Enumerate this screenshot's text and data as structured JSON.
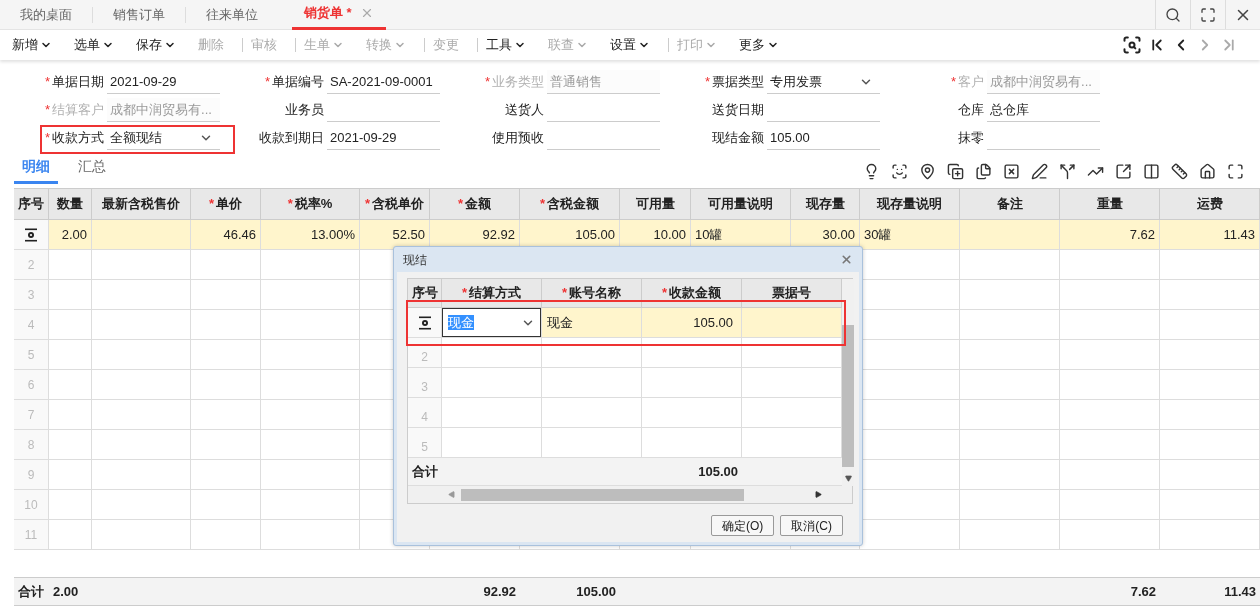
{
  "tabs": [
    {
      "label": "我的桌面",
      "selected": false,
      "closable": false
    },
    {
      "label": "销售订单",
      "selected": false,
      "closable": false
    },
    {
      "label": "往来单位",
      "selected": false,
      "closable": false
    },
    {
      "label": "销货单 *",
      "selected": true,
      "closable": true
    }
  ],
  "toolbar": [
    {
      "kind": "button",
      "label": "新增",
      "dropdown": true,
      "disabled": false
    },
    {
      "kind": "button",
      "label": "选单",
      "dropdown": true,
      "disabled": false
    },
    {
      "kind": "button",
      "label": "保存",
      "dropdown": true,
      "disabled": false
    },
    {
      "kind": "button",
      "label": "删除",
      "dropdown": false,
      "disabled": true
    },
    {
      "kind": "separator"
    },
    {
      "kind": "button",
      "label": "审核",
      "dropdown": false,
      "disabled": true
    },
    {
      "kind": "separator"
    },
    {
      "kind": "button",
      "label": "生单",
      "dropdown": true,
      "disabled": true
    },
    {
      "kind": "button",
      "label": "转换",
      "dropdown": true,
      "disabled": true
    },
    {
      "kind": "separator"
    },
    {
      "kind": "button",
      "label": "变更",
      "dropdown": false,
      "disabled": true
    },
    {
      "kind": "separator"
    },
    {
      "kind": "button",
      "label": "工具",
      "dropdown": true,
      "disabled": false
    },
    {
      "kind": "button",
      "label": "联查",
      "dropdown": true,
      "disabled": true
    },
    {
      "kind": "button",
      "label": "设置",
      "dropdown": true,
      "disabled": false
    },
    {
      "kind": "separator"
    },
    {
      "kind": "button",
      "label": "打印",
      "dropdown": true,
      "disabled": true
    },
    {
      "kind": "button",
      "label": "更多",
      "dropdown": true,
      "disabled": false
    }
  ],
  "nav": [
    {
      "kind": "find",
      "disabled": false
    },
    {
      "kind": "first",
      "disabled": false
    },
    {
      "kind": "prev",
      "disabled": false
    },
    {
      "kind": "next",
      "disabled": true
    },
    {
      "kind": "last",
      "disabled": true
    }
  ],
  "form": [
    [
      {
        "mark": "*",
        "label": "单据日期",
        "value": "2021-09-29",
        "disabled": false,
        "dropdown": false,
        "annotated": false
      },
      {
        "mark": "*",
        "label": "单据编号",
        "value": "SA-2021-09-0001",
        "disabled": false,
        "dropdown": false,
        "annotated": false
      },
      {
        "mark": "*",
        "label": "业务类型",
        "value": "普通销售",
        "disabled": true,
        "dropdown": false,
        "annotated": false
      },
      {
        "mark": "*",
        "label": "票据类型",
        "value": "专用发票",
        "disabled": false,
        "dropdown": true,
        "annotated": false
      },
      {
        "mark": "*",
        "label": "客户",
        "value": "成都中润贸易有...",
        "disabled": true,
        "dropdown": false,
        "annotated": false
      }
    ],
    [
      {
        "mark": "*",
        "label": "结算客户",
        "value": "成都中润贸易有...",
        "disabled": true,
        "dropdown": false,
        "annotated": false
      },
      {
        "label": "业务员",
        "dropdown": false,
        "annotated": false
      },
      {
        "label": "送货人",
        "dropdown": false,
        "annotated": false
      },
      {
        "label": "送货日期",
        "dropdown": false,
        "annotated": false
      },
      {
        "label": "仓库",
        "value": "总仓库",
        "disabled": false,
        "dropdown": false,
        "annotated": false
      }
    ],
    [
      {
        "mark": "*",
        "label": "收款方式",
        "value": "全额现结",
        "disabled": false,
        "dropdown": true,
        "annotated": true
      },
      {
        "label": "收款到期日",
        "value": "2021-09-29",
        "disabled": false,
        "dropdown": false,
        "annotated": false
      },
      {
        "label": "使用预收",
        "dropdown": false,
        "annotated": false
      },
      {
        "label": "现结金额",
        "value": "105.00",
        "disabled": false,
        "dropdown": false,
        "annotated": false
      },
      {
        "label": "抹零",
        "dropdown": false,
        "annotated": false
      }
    ]
  ],
  "detail_tabs": [
    {
      "label": "明细",
      "selected": true
    },
    {
      "label": "汇总",
      "selected": false
    }
  ],
  "table": {
    "columns": [
      {
        "label": "序号"
      },
      {
        "label": "数量"
      },
      {
        "label": "最新含税售价"
      },
      {
        "mark": "*",
        "label": "单价"
      },
      {
        "mark": "*",
        "label": "税率%"
      },
      {
        "mark": "*",
        "label": "含税单价"
      },
      {
        "mark": "*",
        "label": "金额"
      },
      {
        "mark": "*",
        "label": "含税金额"
      },
      {
        "label": "可用量"
      },
      {
        "label": "可用量说明"
      },
      {
        "label": "现存量"
      },
      {
        "label": "现存量说明"
      },
      {
        "label": "备注"
      },
      {
        "label": "重量"
      },
      {
        "label": "运费"
      }
    ],
    "rows": [
      {
        "selected": true,
        "quantity": "2.00",
        "unit_price": "46.46",
        "tax_rate": "13.00%",
        "unit_price_with_tax": "52.50",
        "amount": "92.92",
        "amount_with_tax": "105.00",
        "available": "10.00",
        "available_note": "10罐",
        "on_hand": "30.00",
        "on_hand_note": "30罐",
        "weight": "7.62",
        "freight": "11.43"
      },
      {
        "selected": false,
        "number": "2"
      },
      {
        "selected": false,
        "number": "3"
      },
      {
        "selected": false,
        "number": "4"
      },
      {
        "selected": false,
        "number": "5"
      },
      {
        "selected": false,
        "number": "6"
      },
      {
        "selected": false,
        "number": "7"
      },
      {
        "selected": false,
        "number": "8"
      },
      {
        "selected": false,
        "number": "9"
      },
      {
        "selected": false,
        "number": "10"
      },
      {
        "selected": false,
        "number": "11"
      }
    ],
    "totals": {
      "label": "合计",
      "quantity": "2.00",
      "amount": "92.92",
      "amount_with_tax": "105.00",
      "weight": "7.62",
      "freight": "11.43"
    }
  },
  "dialog": {
    "title": "现结",
    "columns": [
      {
        "label": "序号"
      },
      {
        "mark": "*",
        "label": "结算方式"
      },
      {
        "mark": "*",
        "label": "账号名称"
      },
      {
        "mark": "*",
        "label": "收款金额"
      },
      {
        "label": "票据号"
      }
    ],
    "rows": [
      {
        "selected": true,
        "annotated": true,
        "method": "现金",
        "account": "现金",
        "amount": "105.00"
      },
      {
        "selected": false,
        "annotated": false,
        "number": "2"
      },
      {
        "selected": false,
        "annotated": false,
        "number": "3"
      },
      {
        "selected": false,
        "annotated": false,
        "number": "4"
      },
      {
        "selected": false,
        "annotated": false,
        "number": "5"
      }
    ],
    "total_label": "合计",
    "total_amount": "105.00",
    "buttons": [
      "确定(O)",
      "取消(C)"
    ]
  }
}
